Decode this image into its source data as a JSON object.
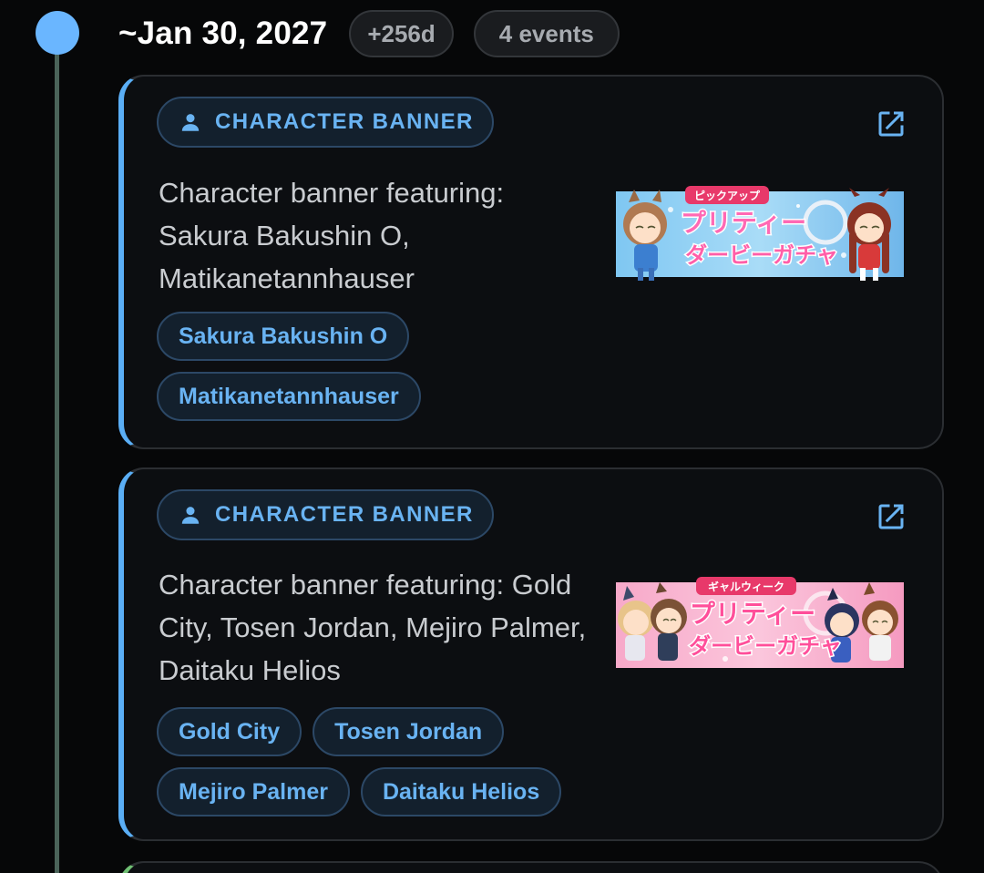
{
  "timeline": {
    "date": "~Jan 30, 2027",
    "offset": "+256d",
    "event_count": "4 events"
  },
  "colors": {
    "accent": "#69b3f2",
    "card_border_character": "#5aaef5",
    "timeline_dot": "#6ab6ff",
    "background": "#060708"
  },
  "events": [
    {
      "type_label": "CHARACTER BANNER",
      "type_icon": "person-icon",
      "link_icon": "external-link-icon",
      "description": "Character banner featuring: Sakura Bakushin O, Matikanetannhauser",
      "tags": [
        "Sakura Bakushin O",
        "Matikanetannhauser"
      ],
      "banner_title_small": "ピックアップ",
      "banner_title": "プリティーダービーガチャ",
      "banner_palette": "blue"
    },
    {
      "type_label": "CHARACTER BANNER",
      "type_icon": "person-icon",
      "link_icon": "external-link-icon",
      "description": "Character banner featuring: Gold City, Tosen Jordan, Mejiro Palmer, Daitaku Helios",
      "tags": [
        "Gold City",
        "Tosen Jordan",
        "Mejiro Palmer",
        "Daitaku Helios"
      ],
      "banner_title_small": "ギャルウィーク",
      "banner_title": "プリティーダービーガチャ",
      "banner_palette": "pink"
    }
  ]
}
